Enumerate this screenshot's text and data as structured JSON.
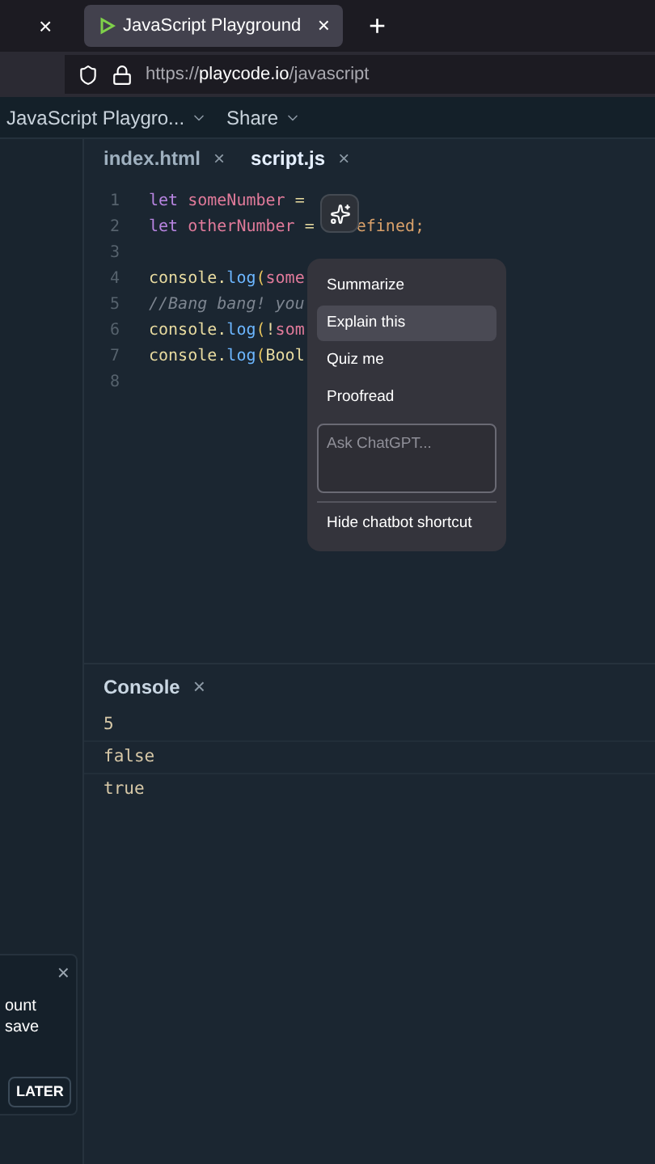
{
  "browser": {
    "tab_close": "×",
    "tab": {
      "title": "JavaScript Playground",
      "close": "×",
      "selected": true
    },
    "new_tab": "+",
    "url": {
      "scheme": "https://",
      "host": "playcode.io",
      "path": "/javascript"
    }
  },
  "app_bar": {
    "project": "JavaScript Playgro...",
    "share": "Share"
  },
  "editor_tabs": [
    {
      "label": "index.html",
      "close": "×",
      "selected": false
    },
    {
      "label": "script.js",
      "close": "×",
      "selected": true
    }
  ],
  "code_lines": [
    {
      "number": "1",
      "tokens": [
        {
          "kind": "keyword",
          "text": "let "
        },
        {
          "kind": "variable",
          "text": "someNumber"
        },
        {
          "kind": "plain",
          "text": " ="
        }
      ]
    },
    {
      "number": "2",
      "tokens": [
        {
          "kind": "keyword",
          "text": "let "
        },
        {
          "kind": "variable",
          "text": "otherNumber"
        },
        {
          "kind": "plain",
          "text": " ="
        },
        {
          "kind": "literal_after_gap",
          "text": "efined;"
        }
      ]
    },
    {
      "number": "3"
    },
    {
      "number": "4",
      "tokens": [
        {
          "kind": "plain",
          "text": "console."
        },
        {
          "kind": "function",
          "text": "log"
        },
        {
          "kind": "paren",
          "text": "("
        },
        {
          "kind": "variable",
          "text": "some"
        }
      ]
    },
    {
      "number": "5",
      "tokens": [
        {
          "kind": "comment",
          "text": "//Bang bang! you"
        }
      ]
    },
    {
      "number": "6",
      "tokens": [
        {
          "kind": "plain",
          "text": "console."
        },
        {
          "kind": "function",
          "text": "log"
        },
        {
          "kind": "paren",
          "text": "("
        },
        {
          "kind": "plain",
          "text": "!"
        },
        {
          "kind": "variable",
          "text": "som"
        }
      ]
    },
    {
      "number": "7",
      "tokens": [
        {
          "kind": "plain",
          "text": "console."
        },
        {
          "kind": "function",
          "text": "log"
        },
        {
          "kind": "paren",
          "text": "("
        },
        {
          "kind": "plain",
          "text": "Bool"
        }
      ]
    },
    {
      "number": "8"
    }
  ],
  "chat_menu": {
    "items": [
      {
        "label": "Summarize",
        "selected": false
      },
      {
        "label": "Explain this",
        "selected": true
      },
      {
        "label": "Quiz me",
        "selected": false
      },
      {
        "label": "Proofread",
        "selected": false
      }
    ],
    "ask_placeholder": "Ask ChatGPT...",
    "hide": "Hide chatbot shortcut"
  },
  "console": {
    "title": "Console",
    "close": "×",
    "lines": [
      "5",
      "false",
      "true"
    ]
  },
  "notification": {
    "close": "×",
    "text": "ount\nsave",
    "button": "LATER"
  }
}
